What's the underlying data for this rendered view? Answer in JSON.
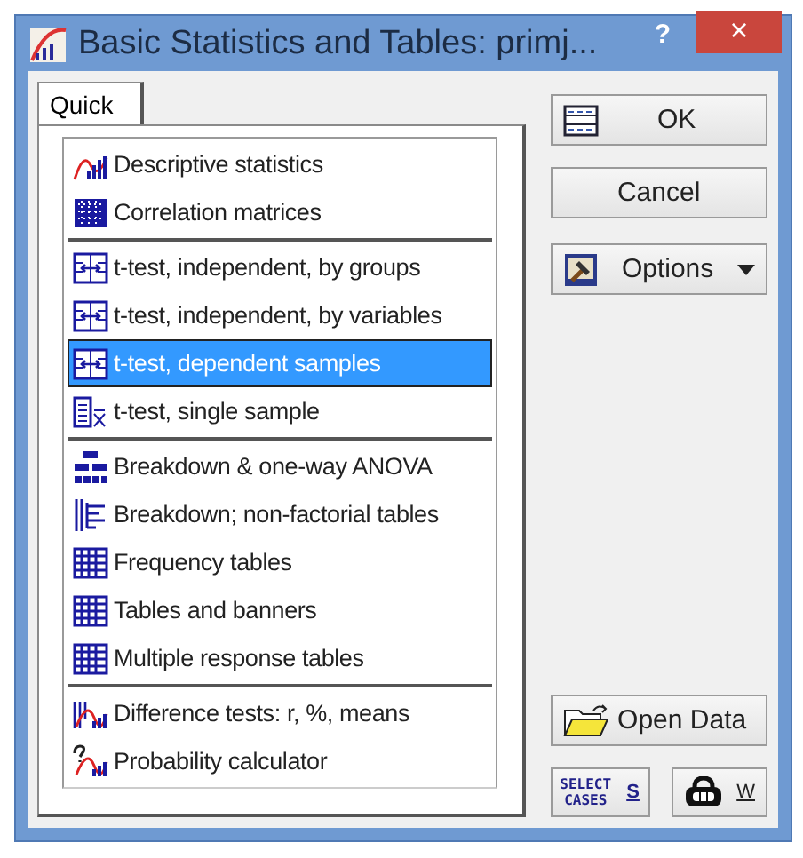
{
  "window": {
    "title": "Basic Statistics and Tables: primj...",
    "help": "?",
    "close": "×"
  },
  "tabs": [
    {
      "label": "Quick",
      "selected": true
    }
  ],
  "groups": [
    {
      "items": [
        {
          "label": "Descriptive statistics",
          "kind": "chart",
          "selected": false
        },
        {
          "label": "Correlation matrices",
          "kind": "matrix",
          "selected": false
        }
      ]
    },
    {
      "items": [
        {
          "label": "t-test, independent, by groups",
          "kind": "ttest",
          "selected": false
        },
        {
          "label": "t-test, independent, by variables",
          "kind": "ttest",
          "selected": false
        },
        {
          "label": "t-test, dependent samples",
          "kind": "ttest",
          "selected": true
        },
        {
          "label": "t-test, single sample",
          "kind": "single",
          "selected": false
        }
      ]
    },
    {
      "items": [
        {
          "label": "Breakdown & one-way ANOVA",
          "kind": "tree",
          "selected": false
        },
        {
          "label": "Breakdown; non-factorial tables",
          "kind": "breakdown",
          "selected": false
        },
        {
          "label": "Frequency tables",
          "kind": "grid",
          "selected": false
        },
        {
          "label": "Tables and banners",
          "kind": "grid",
          "selected": false
        },
        {
          "label": "Multiple response tables",
          "kind": "grid",
          "selected": false
        }
      ]
    },
    {
      "items": [
        {
          "label": "Difference tests: r, %, means",
          "kind": "diff",
          "selected": false
        },
        {
          "label": "Probability calculator",
          "kind": "prob",
          "selected": false
        }
      ]
    }
  ],
  "buttons": {
    "ok": "OK",
    "cancel": "Cancel",
    "options": "Options",
    "open_data": "Open Data",
    "select_cases": {
      "badge": "SELECT CASES",
      "key": "S"
    },
    "weights": {
      "key": "W"
    }
  }
}
